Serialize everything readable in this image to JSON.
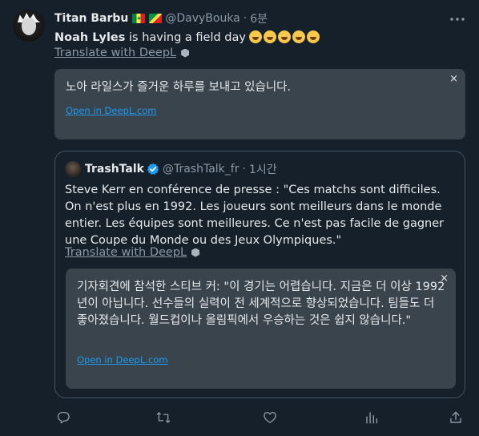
{
  "tweet": {
    "display_name": "Titan Barbu",
    "handle": "@DavyBouka",
    "separator": "·",
    "time": "6분",
    "text_bold": "Noah Lyles",
    "text_rest": " is having a field day",
    "emoji_count": 5,
    "translate_label": "Translate with DeepL",
    "translation": {
      "text": "노아 라일스가 즐거운 하루를 보내고 있습니다.",
      "open_label": "Open in DeepL.com",
      "close_glyph": "×"
    }
  },
  "quote": {
    "display_name": "TrashTalk",
    "handle": "@TrashTalk_fr",
    "separator": "·",
    "time": "1시간",
    "text": "Steve Kerr en conférence de presse : \"Ces matchs sont difficiles. On n'est plus en 1992. Les joueurs sont meilleurs dans le monde entier. Les équipes sont meilleures. Ce n'est pas facile de gagner une Coupe du Monde ou des Jeux Olympiques.\"",
    "translate_label": "Translate with DeepL",
    "translation": {
      "text": "기자회견에 참석한 스티브 커: \"이 경기는 어렵습니다. 지금은 더 이상 1992년이 아닙니다. 선수들의 실력이 전 세계적으로 향상되었습니다. 팀들도 더 좋아졌습니다. 월드컵이나 올림픽에서 우승하는 것은 쉽지 않습니다.\"",
      "open_label": "Open in DeepL.com",
      "close_glyph": "×"
    }
  },
  "icons": {
    "more": "more-icon",
    "reply": "reply-icon",
    "retweet": "retweet-icon",
    "like": "heart-icon",
    "views": "analytics-icon",
    "share": "share-icon",
    "verified": "verified-badge-icon"
  },
  "colors": {
    "background": "#15202b",
    "text_primary": "#e7e9ea",
    "text_secondary": "#8b98a5",
    "translation_box": "#3a444c",
    "link": "#1d9bf0",
    "verified": "#1d9bf0"
  }
}
